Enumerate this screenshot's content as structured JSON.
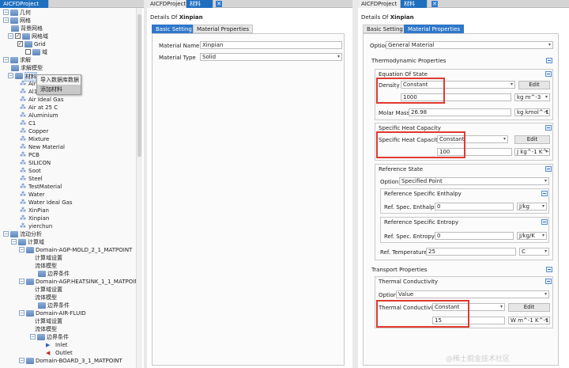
{
  "project_pane": {
    "tab_label": "AICFDProject",
    "tree": [
      {
        "label": "几何"
      },
      {
        "label": "网格"
      },
      {
        "label": "背景网格"
      },
      {
        "label": "网格域"
      },
      {
        "label": "Grid"
      },
      {
        "label": "域"
      },
      {
        "label": "求解"
      },
      {
        "label": "求解模型"
      },
      {
        "label": "材料"
      },
      {
        "label": "Air"
      },
      {
        "label": "Al1"
      },
      {
        "label": "Air Ideal Gas"
      },
      {
        "label": "Air at 25 C"
      },
      {
        "label": "Aluminium"
      },
      {
        "label": "C1"
      },
      {
        "label": "Copper"
      },
      {
        "label": "Mixture"
      },
      {
        "label": "New Material"
      },
      {
        "label": "PCB"
      },
      {
        "label": "SILICON"
      },
      {
        "label": "Soot"
      },
      {
        "label": "Steel"
      },
      {
        "label": "TestMaterial"
      },
      {
        "label": "Water"
      },
      {
        "label": "Water Ideal Gas"
      },
      {
        "label": "XinPian"
      },
      {
        "label": "Xinpian"
      },
      {
        "label": "yierchun"
      },
      {
        "label": "流动分析"
      },
      {
        "label": "计算域"
      },
      {
        "label": "Domain-AGP-MOLD_2_1_MATPOINT"
      },
      {
        "label": "计算域设置"
      },
      {
        "label": "流体模型"
      },
      {
        "label": "边界条件"
      },
      {
        "label": "Domain-AGP.HEATSINK_1_1_MATPOINT"
      },
      {
        "label": "计算域设置"
      },
      {
        "label": "流体模型"
      },
      {
        "label": "边界条件"
      },
      {
        "label": "Domain-AIR-FLUID"
      },
      {
        "label": "计算域设置"
      },
      {
        "label": "流体模型"
      },
      {
        "label": "边界条件"
      },
      {
        "label": "Inlet"
      },
      {
        "label": "Outlet"
      },
      {
        "label": "Domain-BOARD_3_1_MATPOINT"
      }
    ],
    "context_menu": [
      "导入数据库数据",
      "添加材料"
    ]
  },
  "middle_pane": {
    "tab_label": "AICFDProject",
    "tab2_label": "材料",
    "details_prefix": "Details Of",
    "details_name": "Xinpian",
    "subtabs": [
      "Basic Setting",
      "Material Properties"
    ],
    "material_name_label": "Material Name",
    "material_name_value": "Xinpian",
    "material_type_label": "Material Type",
    "material_type_value": "Solid"
  },
  "right_pane": {
    "tab_label": "AICFDProject",
    "tab2_label": "材料",
    "details_prefix": "Details Of",
    "details_name": "Xinpian",
    "subtabs": [
      "Basic Setting",
      "Material Properties"
    ],
    "option_label": "Option",
    "option_value": "General Material",
    "thermo_title": "Thermodynamic Properties",
    "eos_title": "Equation Of State",
    "density_label": "Density",
    "density_mode": "Constant",
    "density_value": "1000",
    "density_unit": "kg m^-3",
    "molar_mass_label": "Molar Mass",
    "molar_mass_value": "26.98",
    "molar_mass_unit": "kg kmol^-1",
    "shc_title": "Specific Heat Capacity",
    "shc_label": "Specific Heat Capacity",
    "shc_mode": "Constant",
    "shc_value": "100",
    "shc_unit": "J kg^-1 K^-1",
    "ref_state_title": "Reference State",
    "ref_option_label": "Option",
    "ref_option_value": "Specified Point",
    "ref_enthalpy_title": "Reference Specific Enthalpy",
    "ref_enthalpy_label": "Ref. Spec. Enthalpy",
    "ref_enthalpy_value": "0",
    "ref_enthalpy_unit": "J/kg",
    "ref_entropy_title": "Reference Specific Entropy",
    "ref_entropy_label": "Ref. Spec. Entropy",
    "ref_entropy_value": "0",
    "ref_entropy_unit": "J/kg/K",
    "ref_temp_label": "Ref. Temperature",
    "ref_temp_value": "25",
    "ref_temp_unit": "C",
    "transport_title": "Transport Properties",
    "tc_title": "Thermal Conductivity",
    "tc_option_label": "Option",
    "tc_option_value": "Value",
    "tc_label": "Thermal Conductivity",
    "tc_mode": "Constant",
    "tc_value": "15",
    "tc_unit": "W m^-1 K^-1",
    "edit_label": "Edit"
  },
  "watermark": "@稀土掘金技术社区"
}
